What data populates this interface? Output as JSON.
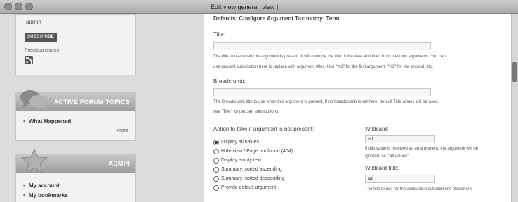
{
  "window": {
    "title": "Edit view general_view |"
  },
  "sidebar": {
    "user_block": {
      "username": "admin",
      "subscribe_label": "SUBSCRIBE",
      "previous_issues_label": "Previous issues",
      "icon": "rss-icon"
    },
    "forum_block": {
      "title": "ACTIVE FORUM TOPICS",
      "icon": "chat-bubbles-icon",
      "items": [
        "What Happened"
      ],
      "more_label": "more"
    },
    "admin_block": {
      "title": "ADMIN",
      "icon": "star-icon",
      "items": [
        "My account",
        "My bookmarks"
      ]
    }
  },
  "form": {
    "heading": "Defaults: Configure Argument Taxonomy: Term",
    "title_field": {
      "label": "Title:",
      "value": "",
      "help_line1": "The title to use when this argument is present. It will override the title of the view and titles from previous arguments. You can",
      "help_line2": "use percent substitution here to replace with argument titles. Use \"%1\" for the first argument, \"%2\" for the second, etc."
    },
    "breadcrumb_field": {
      "label": "Breadcrumb:",
      "value": "",
      "help_line1": "The Breadcrumb title to use when this argument is present. If no breadcrumb is set here, default Title values will be used,",
      "help_line2": "see \"Title\" for percent substitutions."
    },
    "action": {
      "label": "Action to take if argument is not present:",
      "selected_index": 0,
      "options": [
        "Display all values",
        "Hide view / Page not found (404)",
        "Display empty text",
        "Summary, sorted ascending",
        "Summary, sorted descending",
        "Provide default argument"
      ]
    },
    "wildcard": {
      "label": "Wildcard:",
      "value": "all",
      "help_line1": "If this value is received as an argument, the argument will be",
      "help_line2": "ignored; i.e, \"all values\""
    },
    "wildcard_title": {
      "label": "Wildcard title:",
      "value": "All",
      "help": "The title to use for the wildcard in substitutions elsewhere."
    }
  },
  "colors": {
    "window_bg": "#dcdcdc",
    "header_gray": "#9d9d9d",
    "panel_bg": "#ffffff"
  }
}
